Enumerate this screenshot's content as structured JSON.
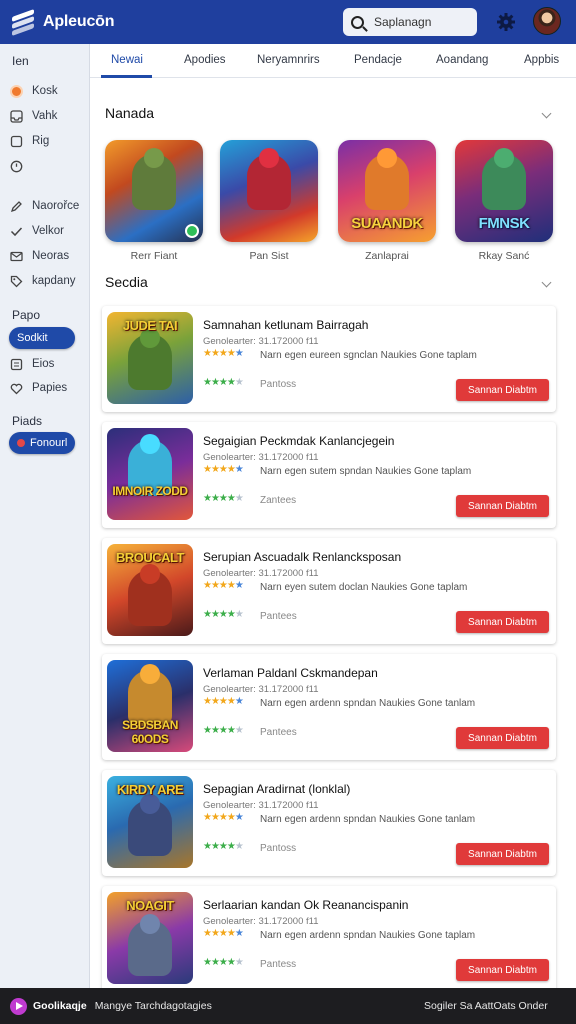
{
  "app": {
    "title": "Apleucōn"
  },
  "search": {
    "placeholder": "Saplanagn"
  },
  "sidebar": {
    "header": "Ien",
    "items_top": [
      {
        "label": "Kosk",
        "icon": "orange-dot-icon"
      },
      {
        "label": "Vahk",
        "icon": "inbox-icon"
      },
      {
        "label": "Rig",
        "icon": "square-icon"
      },
      {
        "label": "",
        "icon": "clock-icon"
      }
    ],
    "items_mid": [
      {
        "label": "Naorořce",
        "icon": "pen-icon"
      },
      {
        "label": "Velkor",
        "icon": "check-icon"
      },
      {
        "label": "Neoras",
        "icon": "envelope-icon"
      },
      {
        "label": "kapdany",
        "icon": "tag-icon"
      }
    ],
    "section2": "Papo",
    "pill1": "Sodkit",
    "items_low": [
      {
        "label": "Eios",
        "icon": "list-icon"
      },
      {
        "label": "Papies",
        "icon": "heart-icon"
      }
    ],
    "section3": "Piads",
    "pill2": "Fonourl"
  },
  "tabs": [
    "Newai",
    "Apodies",
    "Neryamnrirs",
    "Pendacje",
    "Aoandang",
    "Appbis"
  ],
  "featured": {
    "title": "Nanada",
    "items": [
      {
        "caption": "Rerr Fiant",
        "art_text": ""
      },
      {
        "caption": "Pan Sist",
        "art_text": ""
      },
      {
        "caption": "Zanlaprai",
        "art_text": "SUAANDK"
      },
      {
        "caption": "Rkay Sanć",
        "art_text": "FMNSK"
      }
    ]
  },
  "list": {
    "title": "Secdia",
    "items": [
      {
        "title": "Samnahan ketlunam Bairragah",
        "meta": "Genolearter:  31.172000 f11",
        "desc": "Narn egen eureen sgnclan Naukies Gone taplam",
        "platform": "Pantoss",
        "cta": "Sannan Diabtm",
        "thumb_text": "JUDE TAI",
        "stars": 4
      },
      {
        "title": "Segaigian Peckmdak Kanlancjegein",
        "meta": "Genolearter:  31.172000 f11",
        "desc": "Narn egen sutem spndan Naukies Gone taplam",
        "platform": "Zantees",
        "cta": "Sannan Diabtm",
        "thumb_text": "IMNOIR ZODD",
        "stars": 4
      },
      {
        "title": "Serupian Ascuadalk Renlancksposan",
        "meta": "Genolearter:  31.172000 f11",
        "desc": "Narn eyen sutem doclan Naukies Gone taplam",
        "platform": "Pantees",
        "cta": "Sannan Diabtm",
        "thumb_text": "BROUCALT",
        "stars": 4
      },
      {
        "title": "Verlaman Paldanl Cskmandepan",
        "meta": "Genolearter:  31.172000 f11",
        "desc": "Narn egen ardenn spndan Naukies Gone tanlam",
        "platform": "Pantees",
        "cta": "Sannan Diabtm",
        "thumb_text": "SBDSBAN 60ODS",
        "stars": 4
      },
      {
        "title": "Sepagian Aradirnat (lonklal)",
        "meta": "Genolearter:  31.172000 f11",
        "desc": "Narn egen ardenn spndan Naukies Gone tanlam",
        "platform": "Pantoss",
        "cta": "Sannan Diabtm",
        "thumb_text": "KIRDY ARE",
        "stars": 4
      },
      {
        "title": "Serlaarian kandan Ok Reanancispanin",
        "meta": "Genolearter:  31.172000 f11",
        "desc": "Narn egen ardenn spndan Naukies Gone taplam",
        "platform": "Pantess",
        "cta": "Sannan Diabtm",
        "thumb_text": "NOAGIT",
        "stars": 4
      }
    ]
  },
  "bottombar": {
    "left": "Goolikaqje",
    "middle": "Mangye  Tarchdagotagies",
    "right": "Sogiler  Sa  AattOats Onder"
  },
  "colors": {
    "brand": "#1f3f9e",
    "accent": "#1f4aa8",
    "cta": "#e03a3a",
    "star_gold": "#f2a71b",
    "star_green": "#3cae4a"
  }
}
